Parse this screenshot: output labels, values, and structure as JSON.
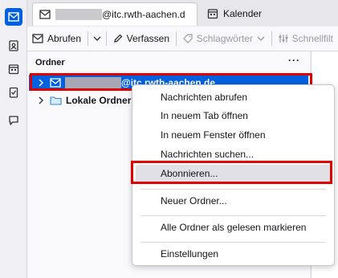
{
  "spaces": {
    "items": [
      {
        "icon": "mail-icon",
        "active": true
      },
      {
        "icon": "address-book-icon",
        "active": false
      },
      {
        "icon": "calendar-icon",
        "active": false
      },
      {
        "icon": "tasks-icon",
        "active": false
      },
      {
        "icon": "chat-icon",
        "active": false
      }
    ]
  },
  "tabs": [
    {
      "icon": "mail-icon",
      "label": "@itc.rwth-aachen.d",
      "active": true
    },
    {
      "icon": "calendar-icon",
      "label": "Kalender",
      "active": false
    }
  ],
  "toolbar": {
    "get_messages": "Abrufen",
    "write": "Verfassen",
    "tags": "Schlagwörter",
    "quick_filter": "Schnellfilt"
  },
  "folder_pane": {
    "title": "Ordner",
    "menu": "···",
    "accounts": [
      {
        "label": "@itc.rwth-aachen.de",
        "selected": true,
        "icon": "mail-icon"
      },
      {
        "label": "Lokale Ordner",
        "selected": false,
        "icon": "folder-icon"
      }
    ]
  },
  "context_menu": {
    "items": [
      "Nachrichten abrufen",
      "In neuem Tab öffnen",
      "In neuem Fenster öffnen",
      "Nachrichten suchen...",
      "Abonnieren...",
      "Neuer Ordner...",
      "Alle Ordner als gelesen markieren",
      "Einstellungen"
    ],
    "highlighted": "Abonnieren..."
  },
  "colors": {
    "accent": "#0060df",
    "highlight_box": "#e00000"
  }
}
